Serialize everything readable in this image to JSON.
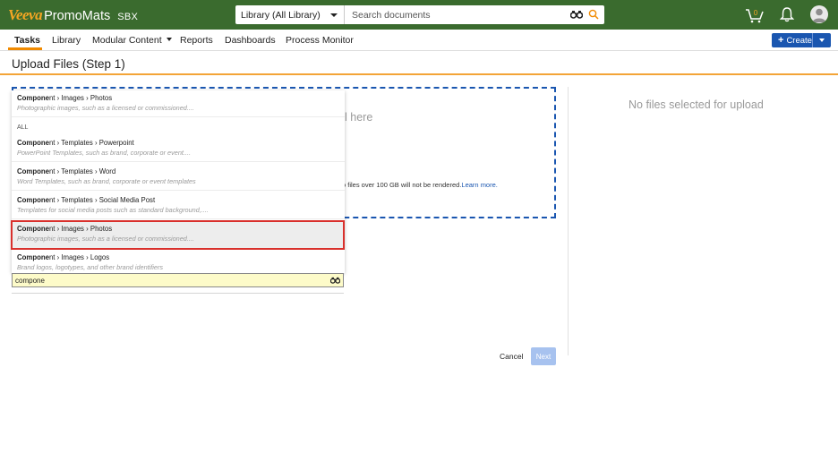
{
  "header": {
    "logo_brand": "Veeva",
    "logo_app": "PromoMats",
    "environment": "SBX",
    "library_select": "Library (All Library)",
    "search_placeholder": "Search documents",
    "cart_count": "0",
    "icons": [
      "binoculars-icon",
      "search-icon",
      "cart-icon",
      "bell-icon",
      "avatar-icon"
    ],
    "colors": {
      "bar": "#3a6b2e",
      "brand": "#f5a623"
    }
  },
  "nav": {
    "items": [
      {
        "label": "Tasks",
        "active": true
      },
      {
        "label": "Library"
      },
      {
        "label": "Modular Content",
        "has_menu": true
      },
      {
        "label": "Reports"
      },
      {
        "label": "Dashboards"
      },
      {
        "label": "Process Monitor"
      }
    ],
    "create_label": "Create"
  },
  "page": {
    "title": "Upload Files (Step 1)"
  },
  "upload": {
    "drop_text": "l here",
    "size_note": "o files over 100 GB will not be rendered.",
    "learn_more": "Learn more.",
    "no_files": "No files selected for upload",
    "cancel_label": "Cancel",
    "next_label": "Next"
  },
  "dropdown": {
    "recent": {
      "match": "Compone",
      "rest": "nt › Images › Photos",
      "desc": "Photographic images, such as a licensed or commissioned...."
    },
    "section_label": "ALL",
    "items": [
      {
        "match": "Compone",
        "rest": "nt › Templates › Powerpoint",
        "desc": "PowerPoint Templates, such as brand, corporate or event...."
      },
      {
        "match": "Compone",
        "rest": "nt › Templates › Word",
        "desc": "Word Templates, such as brand, corporate or event templates"
      },
      {
        "match": "Compone",
        "rest": "nt › Templates › Social Media Post",
        "desc": "Templates for social media posts such as standard background,...."
      },
      {
        "match": "Compone",
        "rest": "nt › Images › Photos",
        "desc": "Photographic images, such as a licensed or commissioned....",
        "selected": true
      },
      {
        "match": "Compone",
        "rest": "nt › Images › Logos",
        "desc": "Brand logos, logotypes, and other brand identifiers"
      }
    ],
    "input_value": "compone"
  }
}
